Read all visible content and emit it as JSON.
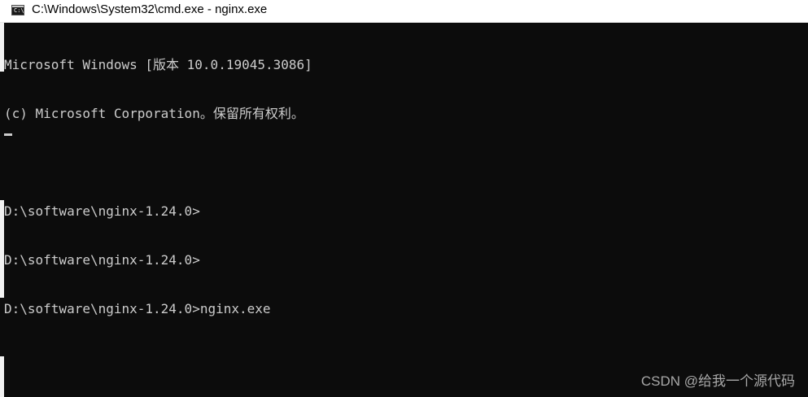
{
  "window": {
    "title": "C:\\Windows\\System32\\cmd.exe - nginx.exe",
    "icon": "cmd-icon",
    "icon_glyph": "C:\\"
  },
  "console": {
    "lines": [
      "Microsoft Windows [版本 10.0.19045.3086]",
      "(c) Microsoft Corporation。保留所有权利。",
      "",
      "D:\\software\\nginx-1.24.0>",
      "D:\\software\\nginx-1.24.0>",
      "D:\\software\\nginx-1.24.0>nginx.exe"
    ]
  },
  "watermark": "CSDN @给我一个源代码",
  "colors": {
    "background": "#0c0c0c",
    "text": "#cccccc",
    "titlebar": "#ffffff"
  }
}
